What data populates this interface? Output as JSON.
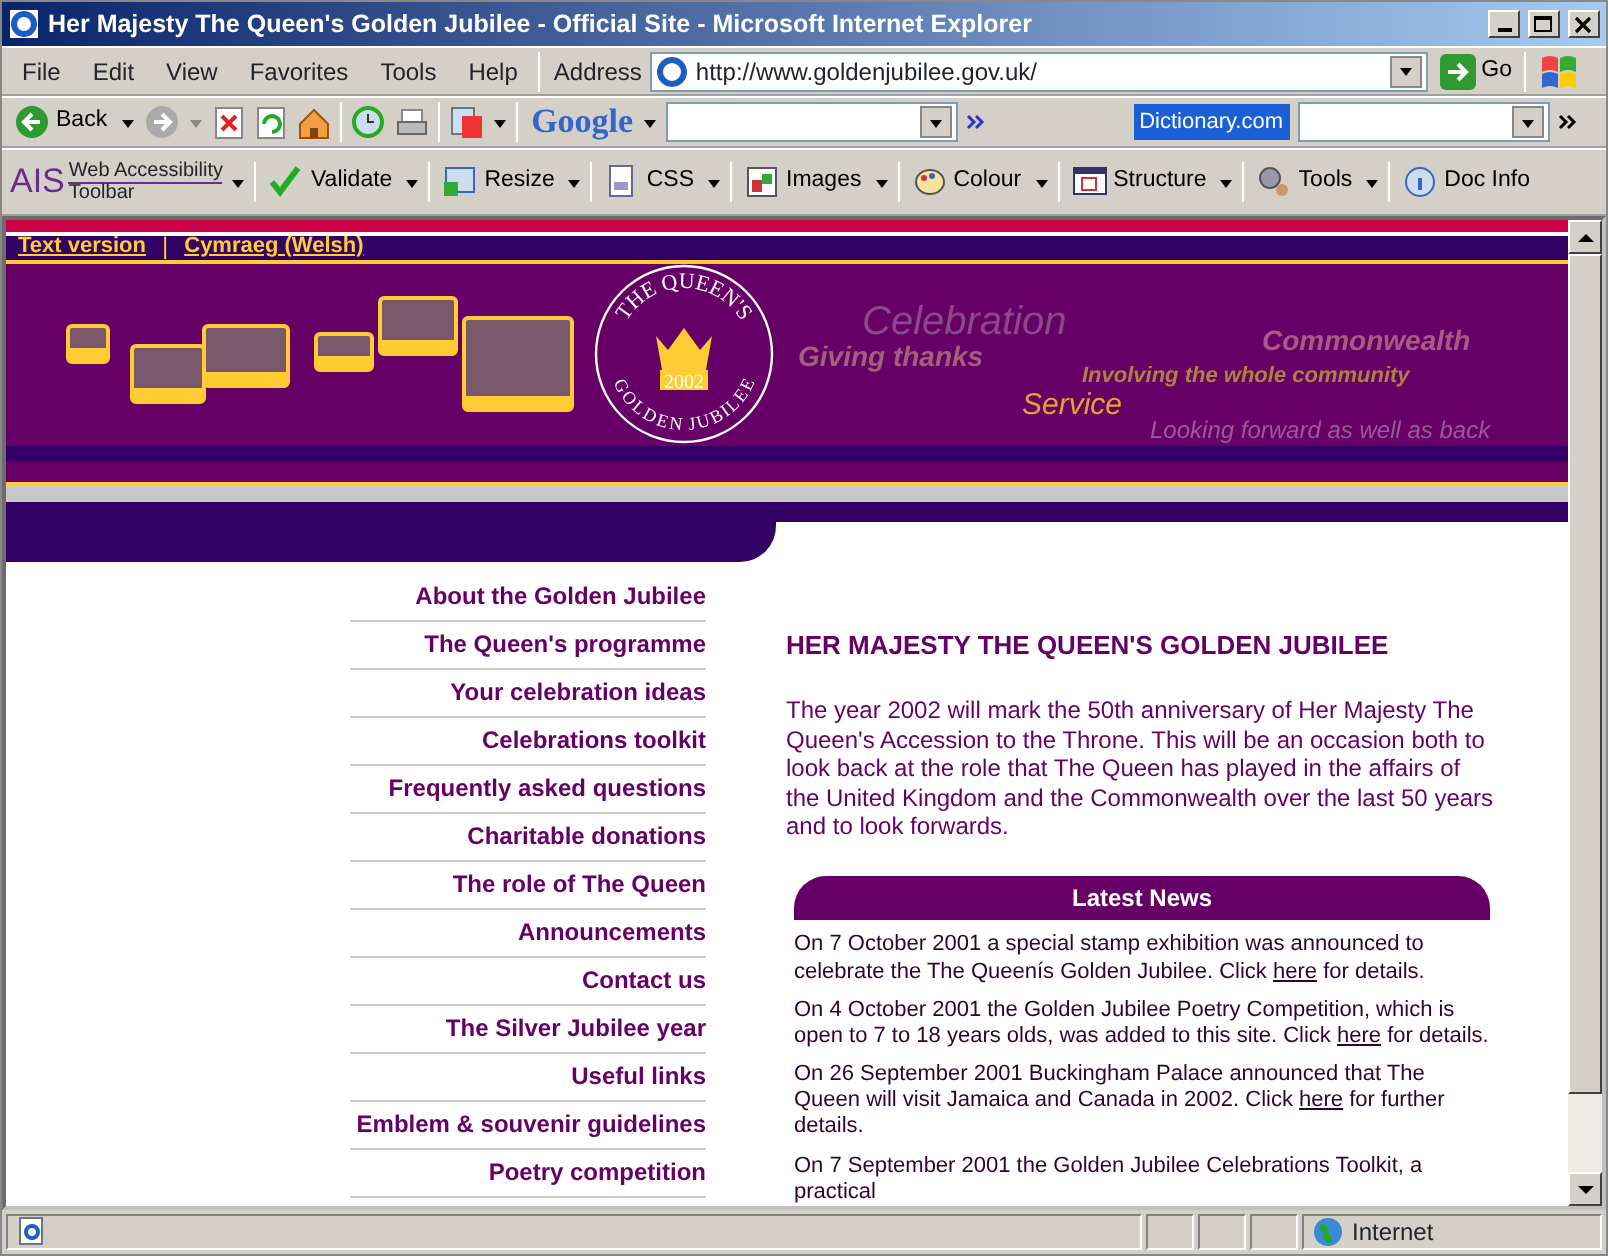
{
  "window": {
    "title": "Her Majesty The Queen's Golden Jubilee - Official Site - Microsoft Internet Explorer"
  },
  "menu": [
    "File",
    "Edit",
    "View",
    "Favorites",
    "Tools",
    "Help"
  ],
  "address": {
    "label": "Address",
    "url": "http://www.goldenjubilee.gov.uk/",
    "go": "Go"
  },
  "toolbar": {
    "back": "Back",
    "google": "Google",
    "dictionary": "Dictionary.com"
  },
  "ais_toolbar": {
    "logo": "AIS",
    "line_1": "Web Accessibility",
    "line_2": "Toolbar",
    "buttons": [
      "Validate",
      "Resize",
      "CSS",
      "Images",
      "Colour",
      "Structure",
      "Tools",
      "Doc Info"
    ]
  },
  "page": {
    "top_links": [
      "Text version",
      "Cymraeg (Welsh)"
    ],
    "separator": "|",
    "emblem": {
      "top_text": "THE QUEEN'S",
      "bottom_text": "GOLDEN JUBILEE",
      "year": "2002"
    },
    "banner_words": [
      "Celebration",
      "Giving thanks",
      "Commonwealth",
      "Involving the whole community",
      "Service",
      "Looking forward as well as back"
    ],
    "nav": [
      "About the Golden Jubilee",
      "The Queen's programme",
      "Your celebration ideas",
      "Celebrations toolkit",
      "Frequently asked questions",
      "Charitable donations",
      "The role of The Queen",
      "Announcements",
      "Contact us",
      "The Silver Jubilee year",
      "Useful links",
      "Emblem & souvenir guidelines",
      "Poetry competition"
    ],
    "heading": "HER MAJESTY THE QUEEN'S GOLDEN JUBILEE",
    "intro": "The year 2002 will mark the 50th anniversary of Her Majesty The Queen's Accession to the Throne. This will be an occasion both to look back at the role that The Queen has played in the affairs of the United Kingdom and the Commonwealth over the last 50 years and to look forwards.",
    "news_title": "Latest News",
    "news": [
      {
        "before": "On 7 October 2001 a special stamp exhibition was announced to celebrate the The Queenís Golden Jubilee. Click ",
        "link": "here",
        "after": " for details."
      },
      {
        "before": "On 4 October 2001 the Golden Jubilee Poetry Competition, which is open to 7 to 18 years olds, was added to this site. Click ",
        "link": "here",
        "after": " for details."
      },
      {
        "before": "On 26 September 2001 Buckingham Palace announced that The Queen will visit Jamaica and Canada in 2002. Click ",
        "link": "here",
        "after": " for further details."
      },
      {
        "before": "On 7 September 2001 the Golden Jubilee Celebrations Toolkit, a practical"
      }
    ]
  },
  "status_bar": {
    "zone": "Internet"
  }
}
